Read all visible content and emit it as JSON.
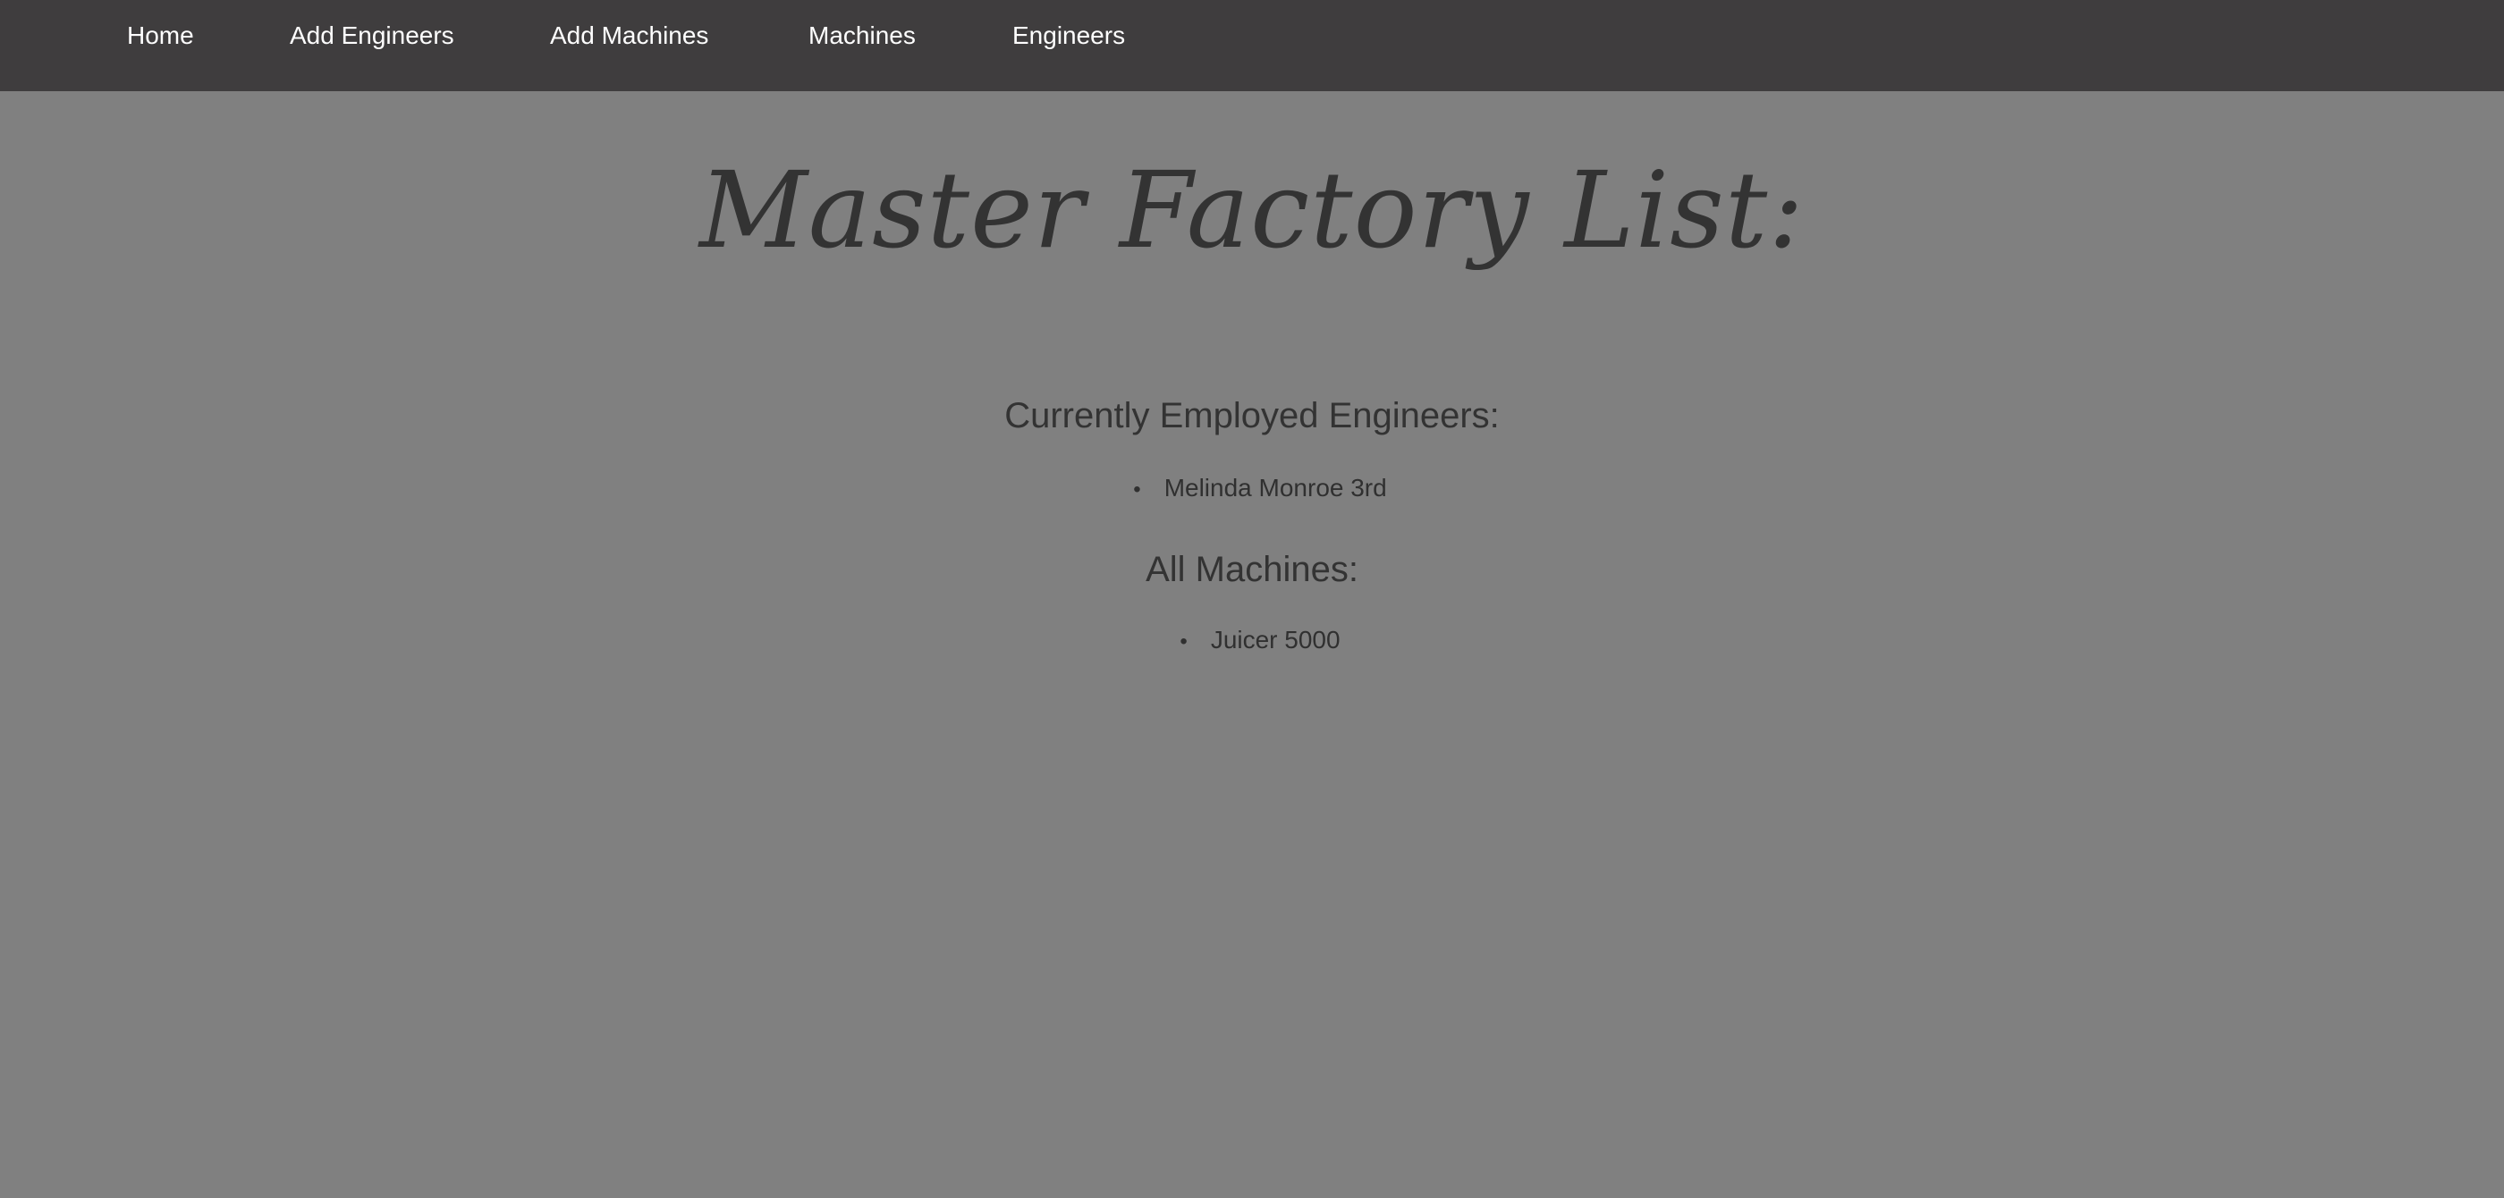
{
  "nav": {
    "items": [
      {
        "label": "Home"
      },
      {
        "label": "Add Engineers"
      },
      {
        "label": "Add Machines"
      },
      {
        "label": "Machines"
      },
      {
        "label": "Engineers"
      }
    ]
  },
  "main": {
    "title": "Master Factory List:",
    "engineers_heading": "Currently Employed Engineers:",
    "engineers": [
      "Melinda Monroe 3rd"
    ],
    "machines_heading": "All Machines:",
    "machines": [
      "Juicer 5000"
    ]
  },
  "colors": {
    "background": "#808080",
    "navbar": "#3f3d3e",
    "nav_text": "#ffffff",
    "body_text": "#333333"
  }
}
